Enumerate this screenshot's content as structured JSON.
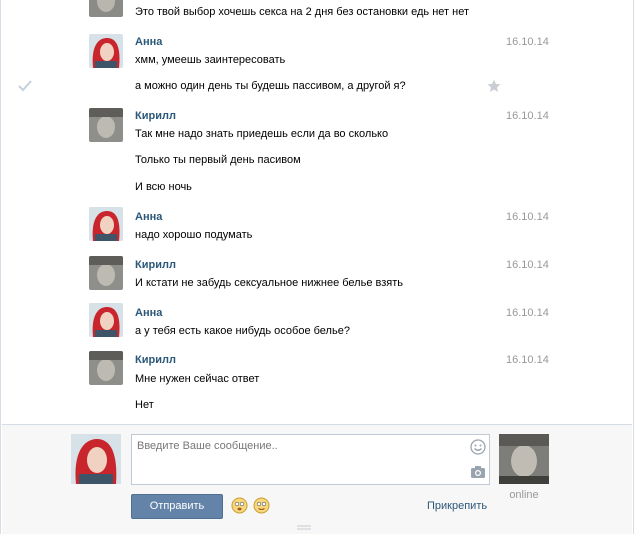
{
  "messages": [
    {
      "text": "Это твой выбор хочешь секса на 2 дня без остановки едь нет нет"
    },
    {
      "author": "Анна",
      "date": "16.10.14",
      "lines": [
        "хмм, умеешь заинтересовать",
        "а можно один день ты будешь пассивом, а другой я?"
      ]
    },
    {
      "author": "Кирилл",
      "date": "16.10.14",
      "lines": [
        "Так мне надо знать приедешь если да во сколько",
        "Только ты первый день пасивом",
        "И всю ночь"
      ]
    },
    {
      "author": "Анна",
      "date": "16.10.14",
      "lines": [
        "надо хорошо подумать"
      ]
    },
    {
      "author": "Кирилл",
      "date": "16.10.14",
      "lines": [
        "И кстати не забудь сексуальное нижнее белье взять"
      ]
    },
    {
      "author": "Анна",
      "date": "16.10.14",
      "lines": [
        "а у тебя есть какое нибудь особое белье?"
      ]
    },
    {
      "author": "Кирилл",
      "date": "16.10.14",
      "lines": [
        "Мне нужен сейчас ответ",
        "Нет"
      ]
    }
  ],
  "composer": {
    "placeholder": "Введите Ваше сообщение..",
    "send_label": "Отправить",
    "attach_label": "Прикрепить",
    "peer_status": "online"
  },
  "colors": {
    "author_link": "#2b587a",
    "send_button": "#6383a8",
    "date": "#999999"
  },
  "icons": [
    "check-icon",
    "star-icon",
    "smile-icon",
    "camera-icon",
    "emoji-icon",
    "resize-handle-icon"
  ]
}
